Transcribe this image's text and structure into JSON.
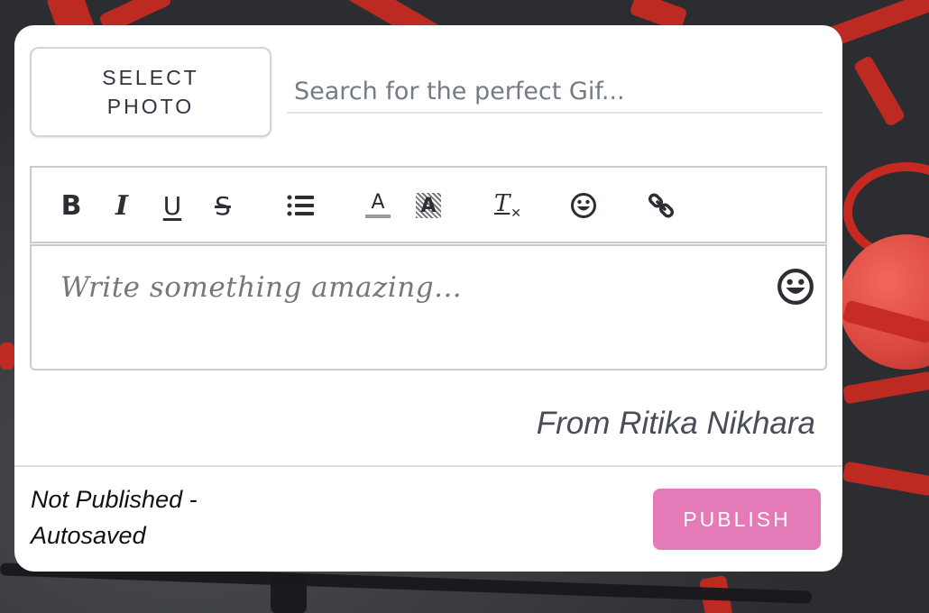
{
  "colors": {
    "accent_publish": "#e47ab8",
    "ribbon_red": "#c42a22",
    "text_dark": "#2b2e33"
  },
  "select_photo": {
    "line1": "SELECT",
    "line2": "PHOTO"
  },
  "gif_search": {
    "placeholder": "Search for the perfect Gif...",
    "value": ""
  },
  "toolbar": {
    "buttons": [
      {
        "name": "bold",
        "icon": "bold-icon"
      },
      {
        "name": "italic",
        "icon": "italic-icon"
      },
      {
        "name": "underline",
        "icon": "underline-icon"
      },
      {
        "name": "strikethrough",
        "icon": "strikethrough-icon"
      },
      {
        "name": "bullet-list",
        "icon": "list-icon"
      },
      {
        "name": "text-color",
        "icon": "text-color-icon"
      },
      {
        "name": "highlight",
        "icon": "highlight-icon"
      },
      {
        "name": "clear-format",
        "icon": "clear-format-icon"
      },
      {
        "name": "emoji",
        "icon": "smiley-icon"
      },
      {
        "name": "link",
        "icon": "link-icon"
      }
    ],
    "glyphs": {
      "bold": "B",
      "italic": "I",
      "underline": "U",
      "strike": "S",
      "text_color": "A",
      "highlight": "A",
      "clear": "T"
    }
  },
  "editor": {
    "placeholder": "Write something amazing..."
  },
  "signature": "From Ritika Nikhara",
  "status": {
    "line1": "Not Published -",
    "line2": "Autosaved"
  },
  "publish_label": "PUBLISH"
}
